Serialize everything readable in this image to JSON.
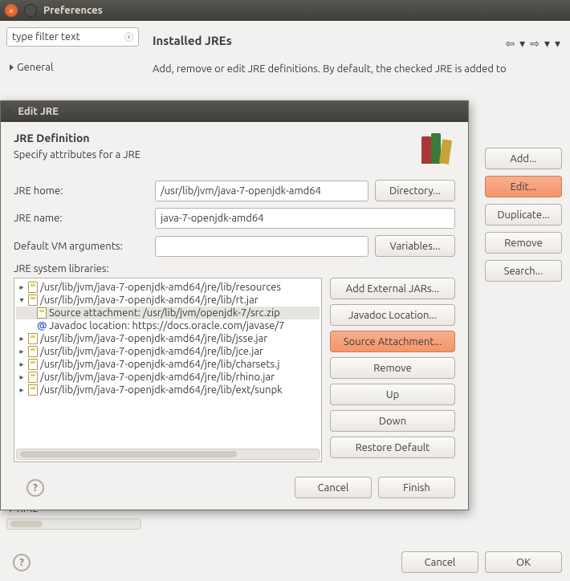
{
  "prefs": {
    "windowTitle": "Preferences",
    "filterPlaceholder": "type filter text",
    "tree": {
      "general": "General",
      "xml": "XML"
    },
    "pageTitle": "Installed JREs",
    "pageDesc": "Add, remove or edit JRE definitions. By default, the checked JRE is added to",
    "buttons": {
      "add": "Add...",
      "edit": "Edit...",
      "duplicate": "Duplicate...",
      "remove": "Remove",
      "search": "Search..."
    },
    "bottom": {
      "cancel": "Cancel",
      "ok": "OK"
    }
  },
  "dlg": {
    "windowTitle": "Edit JRE",
    "headTitle": "JRE Definition",
    "headDesc": "Specify attributes for a JRE",
    "labels": {
      "home": "JRE home:",
      "name": "JRE name:",
      "vmargs": "Default VM arguments:",
      "libs": "JRE system libraries:"
    },
    "fields": {
      "home": "/usr/lib/jvm/java-7-openjdk-amd64",
      "name": "java-7-openjdk-amd64",
      "vmargs": ""
    },
    "rowButtons": {
      "directory": "Directory...",
      "variables": "Variables..."
    },
    "libs": [
      {
        "t": "jar",
        "exp": "▸",
        "text": "/usr/lib/jvm/java-7-openjdk-amd64/jre/lib/resources"
      },
      {
        "t": "jar",
        "exp": "▾",
        "text": "/usr/lib/jvm/java-7-openjdk-amd64/jre/lib/rt.jar"
      },
      {
        "t": "src",
        "sel": true,
        "text": "Source attachment: /usr/lib/jvm/openjdk-7/src.zip"
      },
      {
        "t": "jd",
        "text": "Javadoc location: https://docs.oracle.com/javase/7"
      },
      {
        "t": "jar",
        "exp": "▸",
        "text": "/usr/lib/jvm/java-7-openjdk-amd64/jre/lib/jsse.jar"
      },
      {
        "t": "jar",
        "exp": "▸",
        "text": "/usr/lib/jvm/java-7-openjdk-amd64/jre/lib/jce.jar"
      },
      {
        "t": "jar",
        "exp": "▸",
        "text": "/usr/lib/jvm/java-7-openjdk-amd64/jre/lib/charsets.j"
      },
      {
        "t": "jar",
        "exp": "▸",
        "text": "/usr/lib/jvm/java-7-openjdk-amd64/jre/lib/rhino.jar"
      },
      {
        "t": "jar",
        "exp": "▸",
        "text": "/usr/lib/jvm/java-7-openjdk-amd64/jre/lib/ext/sunpk"
      }
    ],
    "libButtons": {
      "addExt": "Add External JARs...",
      "javadoc": "Javadoc Location...",
      "source": "Source Attachment...",
      "remove": "Remove",
      "up": "Up",
      "down": "Down",
      "restore": "Restore Default"
    },
    "bottom": {
      "cancel": "Cancel",
      "finish": "Finish"
    }
  }
}
